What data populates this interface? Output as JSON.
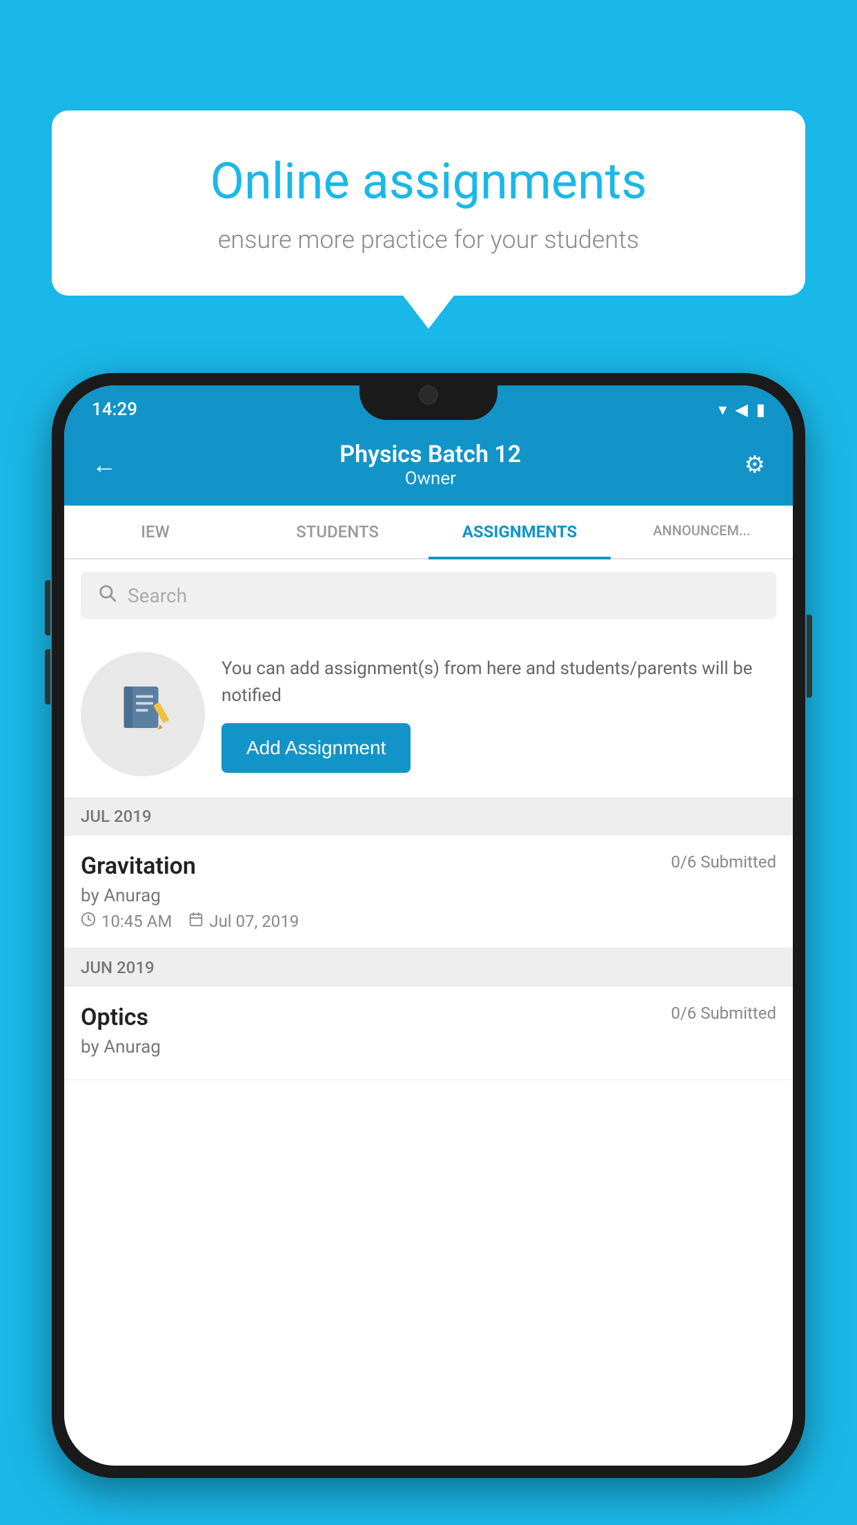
{
  "background_color": "#1ab8e8",
  "speech_bubble": {
    "title": "Online assignments",
    "subtitle": "ensure more practice for your students"
  },
  "status_bar": {
    "time": "14:29",
    "wifi": "▾",
    "signal": "▲",
    "battery": "▮"
  },
  "header": {
    "title": "Physics Batch 12",
    "subtitle": "Owner",
    "back_label": "←",
    "settings_label": "⚙"
  },
  "tabs": [
    {
      "label": "IEW",
      "active": false
    },
    {
      "label": "STUDENTS",
      "active": false
    },
    {
      "label": "ASSIGNMENTS",
      "active": true
    },
    {
      "label": "ANNOUNCEM...",
      "active": false
    }
  ],
  "search": {
    "placeholder": "Search"
  },
  "empty_state": {
    "description": "You can add assignment(s) from here and students/parents will be notified",
    "add_button_label": "Add Assignment"
  },
  "sections": [
    {
      "month_label": "JUL 2019",
      "assignments": [
        {
          "name": "Gravitation",
          "submitted": "0/6 Submitted",
          "by": "by Anurag",
          "time": "10:45 AM",
          "date": "Jul 07, 2019"
        }
      ]
    },
    {
      "month_label": "JUN 2019",
      "assignments": [
        {
          "name": "Optics",
          "submitted": "0/6 Submitted",
          "by": "by Anurag",
          "time": "",
          "date": ""
        }
      ]
    }
  ]
}
